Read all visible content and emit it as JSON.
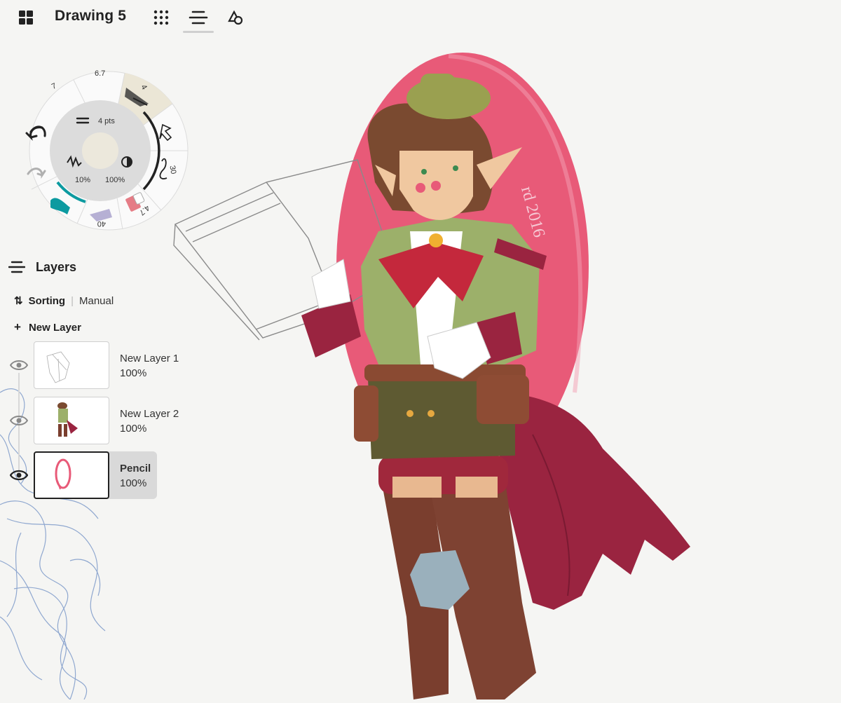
{
  "app": {
    "title": "Drawing 5",
    "icons": [
      "gallery-grid-icon",
      "brush-library-icon",
      "layers-icon",
      "shapes-icon"
    ]
  },
  "tool_wheel": {
    "brush_size_label": "4 pts",
    "smoothing_label": "10%",
    "opacity_label": "100%",
    "presets": [
      {
        "label": "6.7",
        "icon": "brush-preset-icon"
      },
      {
        "label": "7",
        "icon": "brush-preset-icon"
      },
      {
        "label": "4",
        "icon": "charcoal-brush-icon"
      },
      {
        "label": "30",
        "icon": "curve-brush-icon"
      },
      {
        "label": "4.7",
        "icon": "eraser-icon"
      },
      {
        "label": "40",
        "icon": "marker-brush-icon"
      }
    ],
    "colors": {
      "accent": "#0c9aa0",
      "eraser": "#e57c86",
      "current": "#ece8dc"
    }
  },
  "layers": {
    "title": "Layers",
    "sorting_label": "Sorting",
    "sorting_value": "Manual",
    "new_layer_label": "New Layer",
    "items": [
      {
        "name": "New Layer 1",
        "opacity": "100%",
        "selected": false
      },
      {
        "name": "New Layer 2",
        "opacity": "100%",
        "selected": false
      },
      {
        "name": "Pencil",
        "opacity": "100%",
        "selected": true
      }
    ]
  },
  "artwork": {
    "signature": "rd 2016",
    "colors": {
      "background_oval": "#e85a78",
      "jacket": "#9cb06a",
      "cape": "#9a2440",
      "boots": "#7a3e2e",
      "hair": "#7a4a30"
    }
  }
}
